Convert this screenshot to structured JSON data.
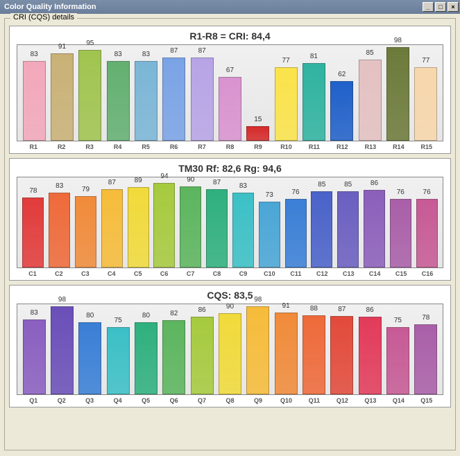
{
  "window": {
    "title": "Color Quality Information"
  },
  "groupbox": {
    "label": "CRI (CQS) details"
  },
  "chart_data": [
    {
      "type": "bar",
      "title": "R1-R8 = CRI: 84,4",
      "ylim": [
        0,
        100
      ],
      "categories": [
        "R1",
        "R2",
        "R3",
        "R4",
        "R5",
        "R6",
        "R7",
        "R8",
        "R9",
        "R10",
        "R11",
        "R12",
        "R13",
        "R14",
        "R15"
      ],
      "values": [
        83,
        91,
        95,
        83,
        83,
        87,
        87,
        67,
        15,
        77,
        81,
        62,
        85,
        98,
        77
      ],
      "colors": [
        "#f2a8bb",
        "#c9b176",
        "#a0c44f",
        "#63b071",
        "#7bb6d6",
        "#7aa3e6",
        "#b7a4e6",
        "#d993cf",
        "#d62a2a",
        "#fbe34a",
        "#2fb3a0",
        "#2060c9",
        "#e4c1c2",
        "#6c7a3a",
        "#f7d7ac"
      ]
    },
    {
      "type": "bar",
      "title": "TM30  Rf: 82,6   Rg: 94,6",
      "ylim": [
        0,
        100
      ],
      "categories": [
        "C1",
        "C2",
        "C3",
        "C4",
        "C5",
        "C6",
        "C7",
        "C8",
        "C9",
        "C10",
        "C11",
        "C12",
        "C13",
        "C14",
        "C15",
        "C16"
      ],
      "values": [
        78,
        83,
        79,
        87,
        89,
        94,
        90,
        87,
        83,
        73,
        76,
        85,
        85,
        86,
        76,
        76
      ],
      "colors": [
        "#e23b3b",
        "#ee6a3a",
        "#f08b3a",
        "#f6bc3a",
        "#f1da3a",
        "#a6ca3e",
        "#5cb55e",
        "#2fb07e",
        "#3bc0c6",
        "#4aa6d6",
        "#3a7fd6",
        "#4a62c9",
        "#6a5fc0",
        "#8b5fba",
        "#a95fa8",
        "#c75a95"
      ]
    },
    {
      "type": "bar",
      "title": "CQS: 83,5",
      "ylim": [
        0,
        100
      ],
      "categories": [
        "Q1",
        "Q2",
        "Q3",
        "Q4",
        "Q5",
        "Q6",
        "Q7",
        "Q8",
        "Q9",
        "Q10",
        "Q11",
        "Q12",
        "Q13",
        "Q14",
        "Q15"
      ],
      "values": [
        83,
        98,
        80,
        75,
        80,
        82,
        86,
        90,
        98,
        91,
        88,
        87,
        86,
        75,
        78
      ],
      "colors": [
        "#8a5fc0",
        "#6a4fb8",
        "#3a7fd6",
        "#3bc0c6",
        "#2fb07e",
        "#5cb55e",
        "#a6ca3e",
        "#f1da3a",
        "#f6bc3a",
        "#f08b3a",
        "#ee6a3a",
        "#e24a3a",
        "#e23b5a",
        "#c75a95",
        "#a95fa8"
      ]
    }
  ]
}
